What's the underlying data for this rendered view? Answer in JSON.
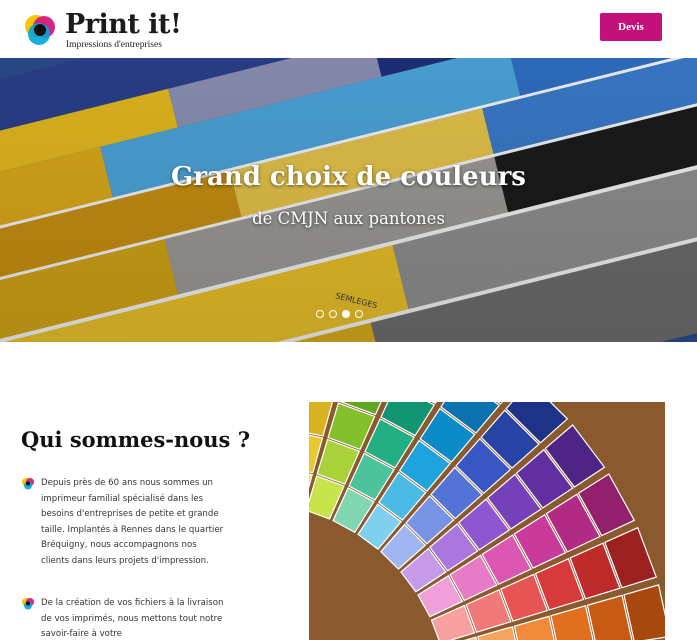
{
  "header": {
    "logo_title": "Print it!",
    "logo_subtitle": "Impressions d'entreprises",
    "cta_label": "Devis"
  },
  "hero": {
    "title": "Grand choix de couleurs",
    "subtitle": "de CMJN aux pantones",
    "swatch_label": "SEMLEGES",
    "slides": 4,
    "active_slide": 3
  },
  "about": {
    "title": "Qui sommes-nous ?",
    "paragraphs": [
      "Depuis près de 60 ans nous sommes un imprimeur familial spécialisé dans les besoins d'entreprises de petite et grande taille. Implantés à Rennes dans le quartier Bréquigny, nous accompagnons nos clients dans leurs projets d'impression.",
      "De la création de vos fichiers à la livraison de vos imprimés, nous mettons tout notre savoir-faire à votre"
    ]
  },
  "colors": {
    "brand_magenta": "#c4107a",
    "logo_cyan": "#00a6d6",
    "logo_magenta": "#d3127f",
    "logo_yellow": "#f7c600",
    "logo_black": "#111111"
  },
  "icons": {
    "logo": "cmyk-circles-logo",
    "bullet": "cmyk-circles-bullet",
    "carousel": "carousel-dot"
  }
}
